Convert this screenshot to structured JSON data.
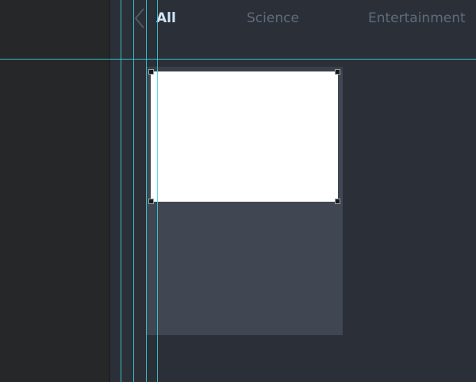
{
  "tabs": {
    "back_icon": "chevron-left-icon",
    "items": [
      {
        "label": "All",
        "active": true
      },
      {
        "label": "Science",
        "active": false
      },
      {
        "label": "Entertainment",
        "active": false
      }
    ]
  },
  "card": {
    "image": "image-placeholder",
    "selected": true
  },
  "colors": {
    "guide": "#39d3dc",
    "active_tab": "#cfe6f7",
    "inactive_tab": "#5e6c7d",
    "canvas": "#2b2f37",
    "card": "#404752"
  }
}
